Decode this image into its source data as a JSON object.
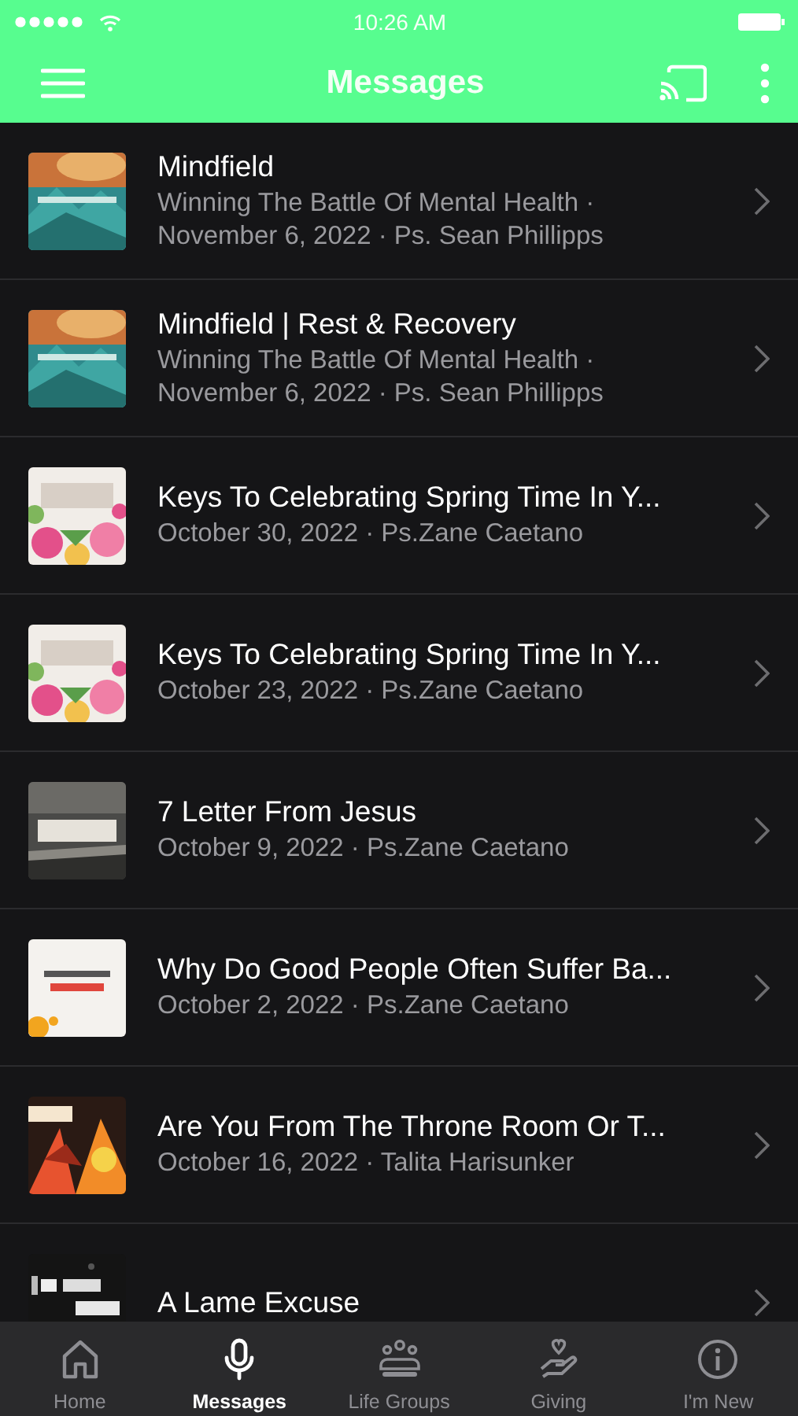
{
  "status_bar": {
    "time": "10:26 AM"
  },
  "nav_bar": {
    "title": "Messages"
  },
  "messages": [
    {
      "title": "Mindfield",
      "subtitle": "Winning The Battle Of Mental Health ·\nNovember 6, 2022 · Ps. Sean Phillipps"
    },
    {
      "title": "Mindfield | Rest & Recovery",
      "subtitle": "Winning The Battle Of Mental Health ·\nNovember 6, 2022 · Ps. Sean Phillipps"
    },
    {
      "title": "Keys To Celebrating Spring Time In Y...",
      "subtitle": "October 30, 2022 · Ps.Zane Caetano"
    },
    {
      "title": "Keys To Celebrating Spring Time In Y...",
      "subtitle": "October 23, 2022 · Ps.Zane Caetano"
    },
    {
      "title": "7 Letter From Jesus",
      "subtitle": "October 9, 2022 · Ps.Zane Caetano"
    },
    {
      "title": "Why Do Good People Often Suffer Ba...",
      "subtitle": "October 2, 2022 · Ps.Zane Caetano"
    },
    {
      "title": "Are You From The Throne Room Or T...",
      "subtitle": "October 16, 2022 · Talita Harisunker"
    },
    {
      "title": "A Lame Excuse"
    }
  ],
  "tab_bar": [
    {
      "label": "Home",
      "selected": false
    },
    {
      "label": "Messages",
      "selected": true
    },
    {
      "label": "Life Groups",
      "selected": false
    },
    {
      "label": "Giving",
      "selected": false
    },
    {
      "label": "I'm New",
      "selected": false
    }
  ]
}
